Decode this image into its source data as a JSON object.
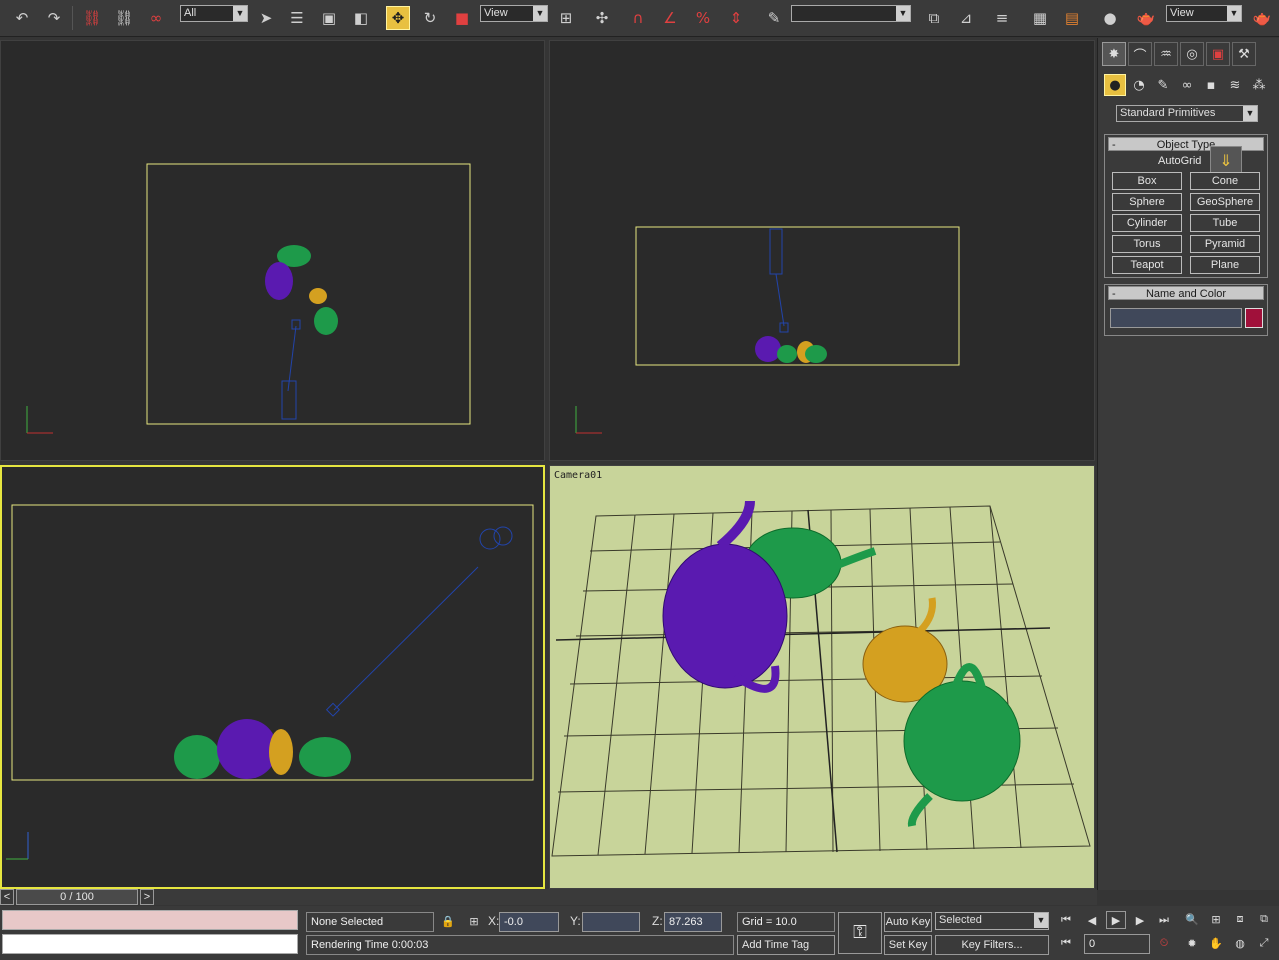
{
  "toolbar": {
    "selection_filter": "All",
    "ref_coord_1": "View",
    "named_selection": "",
    "ref_coord_2": "View"
  },
  "viewports": {
    "camera_label": "Camera01"
  },
  "command_panel": {
    "category_dropdown": "Standard Primitives",
    "object_type": {
      "title": "Object Type",
      "toggle": "-",
      "autogrid": "AutoGrid",
      "buttons": [
        "Box",
        "Cone",
        "Sphere",
        "GeoSphere",
        "Cylinder",
        "Tube",
        "Torus",
        "Pyramid",
        "Teapot",
        "Plane"
      ]
    },
    "name_and_color": {
      "title": "Name and Color",
      "toggle": "-",
      "name_value": "",
      "color": "#a0103a"
    }
  },
  "timeline": {
    "slider_label": "0 / 100",
    "prev": "<",
    "next": ">"
  },
  "status": {
    "selection": "None Selected",
    "rendering_time": "Rendering Time  0:00:03",
    "x_label": "X:",
    "x_value": "-0.0",
    "y_label": "Y:",
    "y_value": "",
    "z_label": "Z:",
    "z_value": "87.263",
    "grid": "Grid = 10.0",
    "add_time_tag": "Add Time Tag"
  },
  "animation": {
    "auto_key": "Auto Key",
    "set_key": "Set Key",
    "key_mode": "Selected",
    "key_filters": "Key Filters...",
    "current_frame": "0"
  },
  "colors": {
    "active_border": "#e6e640",
    "camera_bg": "#c8d49a",
    "teapot_purple": "#5a1ab0",
    "teapot_green": "#1e9a4a",
    "teapot_gold": "#d4a020",
    "camera_blue": "#2244aa"
  }
}
